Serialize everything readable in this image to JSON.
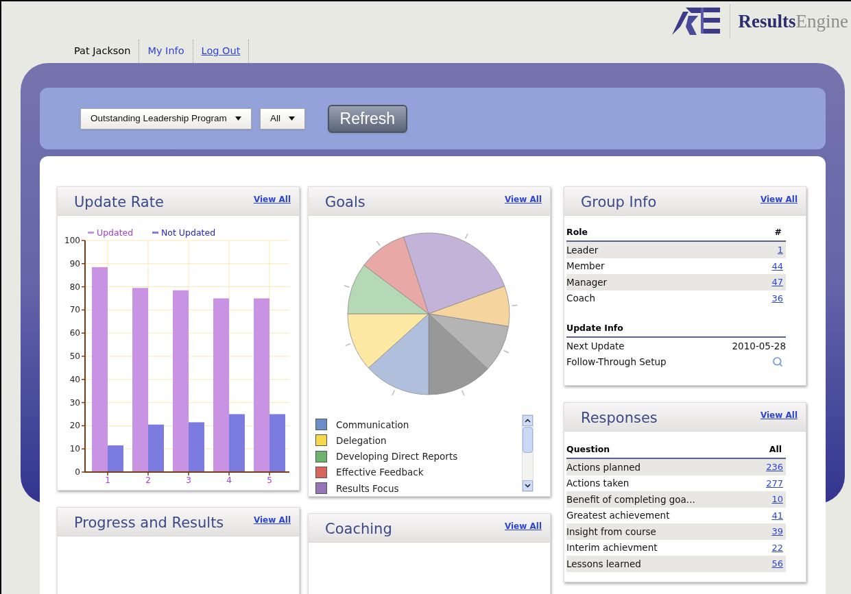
{
  "logo": {
    "bold": "Results",
    "light": "Engine"
  },
  "user_nav": {
    "name": "Pat Jackson",
    "links": [
      {
        "label": "My Info",
        "underlined": false
      },
      {
        "label": "Log Out",
        "underlined": true
      }
    ]
  },
  "filters": {
    "selects": [
      "Outstanding Leadership Program",
      "All"
    ],
    "button": "Refresh"
  },
  "update_rate": {
    "title": "Update Rate",
    "link": "View All",
    "chart_data": {
      "type": "bar",
      "categories": [
        "1",
        "2",
        "3",
        "4",
        "5"
      ],
      "series": [
        {
          "name": "Updated",
          "color": "#c993e3",
          "values": [
            88.5,
            79.5,
            78.5,
            75,
            75
          ]
        },
        {
          "name": "Not Updated",
          "color": "#7b7be0",
          "values": [
            11.5,
            20.5,
            21.5,
            25,
            25
          ]
        }
      ],
      "ylim": [
        0,
        100
      ],
      "yticks": [
        0,
        10,
        20,
        30,
        40,
        50,
        60,
        70,
        80,
        90,
        100
      ],
      "grid": true,
      "legend": "top"
    }
  },
  "goals": {
    "title": "Goals",
    "link": "View All",
    "legend": [
      {
        "label": "Communication",
        "color": "#6b8cc7"
      },
      {
        "label": "Delegation",
        "color": "#f5d94a"
      },
      {
        "label": "Developing Direct Reports",
        "color": "#6db36d"
      },
      {
        "label": "Effective Feedback",
        "color": "#d9645c"
      },
      {
        "label": "Results Focus",
        "color": "#9575b8"
      }
    ]
  },
  "group_info": {
    "title": "Group Info",
    "link": "View All",
    "roles": {
      "columns": [
        "Role",
        "#"
      ],
      "rows": [
        {
          "label": "Leader",
          "value": "1"
        },
        {
          "label": "Member",
          "value": "44"
        },
        {
          "label": "Manager",
          "value": "47"
        },
        {
          "label": "Coach",
          "value": "36"
        }
      ]
    },
    "update_info": {
      "heading": "Update Info",
      "rows": [
        {
          "label": "Next Update",
          "kind": "text",
          "value": "2010-05-28"
        },
        {
          "label": "Follow-Through Setup",
          "kind": "icon"
        }
      ]
    }
  },
  "responses": {
    "title": "Responses",
    "link": "View All",
    "columns": [
      "Question",
      "All"
    ],
    "rows": [
      {
        "label": "Actions planned",
        "value": "236"
      },
      {
        "label": "Actions taken",
        "value": "277"
      },
      {
        "label": "Benefit of completing goa...",
        "value": "10"
      },
      {
        "label": "Greatest achievement",
        "value": "41"
      },
      {
        "label": "Insight from course",
        "value": "39"
      },
      {
        "label": "Interim achievment",
        "value": "22"
      },
      {
        "label": "Lessons learned",
        "value": "56"
      }
    ]
  },
  "bottom_cards": [
    {
      "title": "Progress and Results",
      "link": "View All"
    },
    {
      "title": "Coaching",
      "link": "View All"
    }
  ]
}
